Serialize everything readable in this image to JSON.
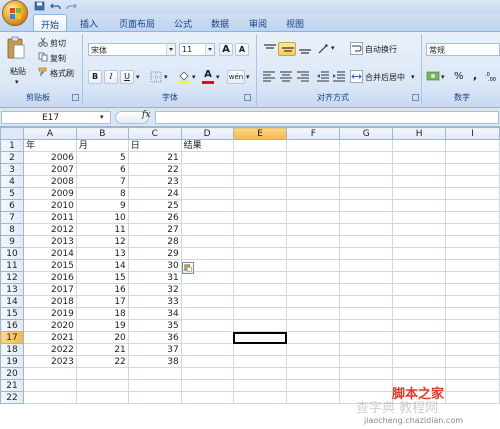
{
  "ribbon_tabs": [
    "开始",
    "插入",
    "页面布局",
    "公式",
    "数据",
    "审阅",
    "视图"
  ],
  "clipboard": {
    "paste": "粘贴",
    "cut": "剪切",
    "copy": "复制",
    "format_painter": "格式刷",
    "group_label": "剪贴板"
  },
  "font": {
    "name": "宋体",
    "size": "11",
    "grow": "A",
    "shrink": "A",
    "bold": "B",
    "italic": "I",
    "underline": "U",
    "color_a": "A",
    "phonetic": "wén",
    "group_label": "字体"
  },
  "alignment": {
    "wrap": "自动换行",
    "merge": "合并后居中",
    "group_label": "对齐方式"
  },
  "number": {
    "format": "常规",
    "percent": "%",
    "comma": ",",
    "group_label": "数字"
  },
  "formula_bar": {
    "name_box": "E17",
    "fx": "fx",
    "value": ""
  },
  "sheet": {
    "columns": [
      "A",
      "B",
      "C",
      "D",
      "E",
      "F",
      "G",
      "H",
      "I"
    ],
    "selected_column": "E",
    "selected_row": 17,
    "rows": [
      {
        "n": 1,
        "a": "年",
        "b": "月",
        "c": "日",
        "d": "结果"
      },
      {
        "n": 2,
        "a": "2006",
        "b": "5",
        "c": "21",
        "d": ""
      },
      {
        "n": 3,
        "a": "2007",
        "b": "6",
        "c": "22",
        "d": ""
      },
      {
        "n": 4,
        "a": "2008",
        "b": "7",
        "c": "23",
        "d": ""
      },
      {
        "n": 5,
        "a": "2009",
        "b": "8",
        "c": "24",
        "d": ""
      },
      {
        "n": 6,
        "a": "2010",
        "b": "9",
        "c": "25",
        "d": ""
      },
      {
        "n": 7,
        "a": "2011",
        "b": "10",
        "c": "26",
        "d": ""
      },
      {
        "n": 8,
        "a": "2012",
        "b": "11",
        "c": "27",
        "d": ""
      },
      {
        "n": 9,
        "a": "2013",
        "b": "12",
        "c": "28",
        "d": ""
      },
      {
        "n": 10,
        "a": "2014",
        "b": "13",
        "c": "29",
        "d": ""
      },
      {
        "n": 11,
        "a": "2015",
        "b": "14",
        "c": "30",
        "d": ""
      },
      {
        "n": 12,
        "a": "2016",
        "b": "15",
        "c": "31",
        "d": ""
      },
      {
        "n": 13,
        "a": "2017",
        "b": "16",
        "c": "32",
        "d": ""
      },
      {
        "n": 14,
        "a": "2018",
        "b": "17",
        "c": "33",
        "d": ""
      },
      {
        "n": 15,
        "a": "2019",
        "b": "18",
        "c": "34",
        "d": ""
      },
      {
        "n": 16,
        "a": "2020",
        "b": "19",
        "c": "35",
        "d": ""
      },
      {
        "n": 17,
        "a": "2021",
        "b": "20",
        "c": "36",
        "d": ""
      },
      {
        "n": 18,
        "a": "2022",
        "b": "21",
        "c": "37",
        "d": ""
      },
      {
        "n": 19,
        "a": "2023",
        "b": "22",
        "c": "38",
        "d": ""
      },
      {
        "n": 20,
        "a": "",
        "b": "",
        "c": "",
        "d": ""
      },
      {
        "n": 21,
        "a": "",
        "b": "",
        "c": "",
        "d": ""
      },
      {
        "n": 22,
        "a": "",
        "b": "",
        "c": "",
        "d": ""
      }
    ]
  },
  "watermark": {
    "brand": "脚本之家",
    "domain": "jiaocheng.chazidian.com",
    "faint": "查字典 教程网"
  },
  "colors": {
    "ribbon_bg": "#dbe7f6",
    "selected_header": "#f5b64b",
    "tab_text": "#15428b",
    "font_color_bar": "#ff0000",
    "fill_color_bar": "#ffff00",
    "watermark_red": "#e03a2b"
  },
  "icons": [
    "office-button",
    "save-icon",
    "undo-icon",
    "redo-icon",
    "paste-icon",
    "scissors-icon",
    "copy-icon",
    "format-painter-icon",
    "border-icon",
    "fill-color-icon",
    "font-color-icon",
    "align-icons",
    "merge-icon",
    "currency-icon",
    "fx-icon",
    "paste-options-icon"
  ]
}
